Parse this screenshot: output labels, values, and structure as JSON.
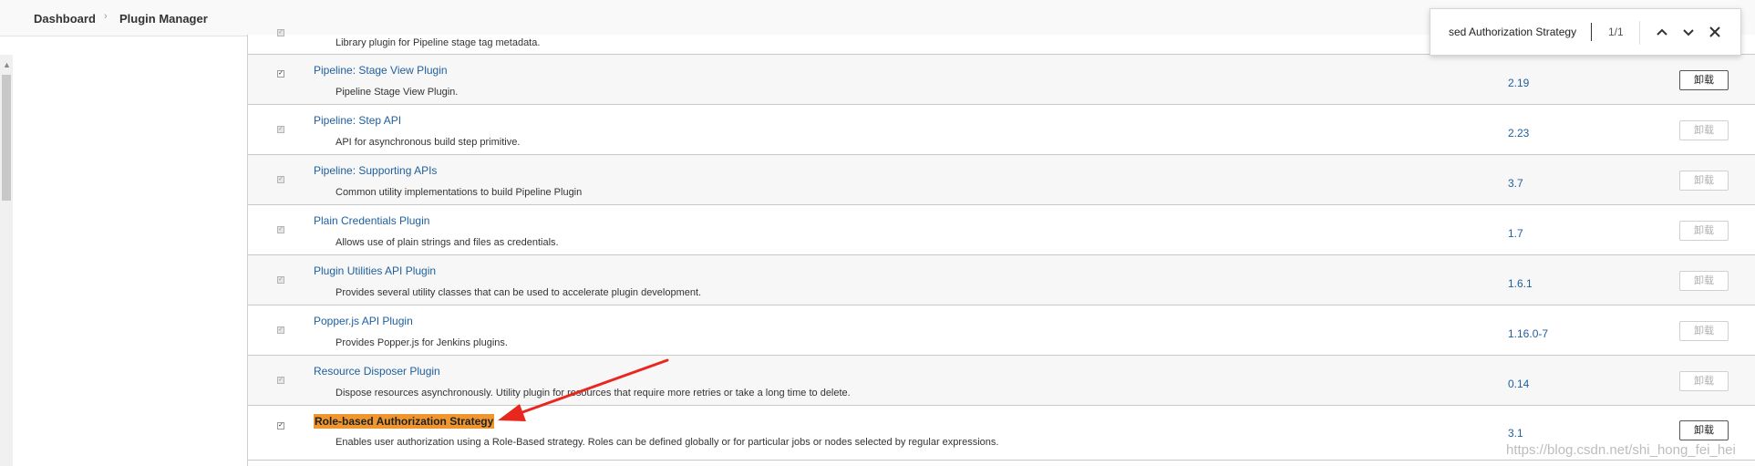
{
  "breadcrumb": {
    "items": [
      "Dashboard",
      "Plugin Manager"
    ]
  },
  "find_bar": {
    "query": "sed Authorization Strategy",
    "match_count": "1/1",
    "icons": [
      "chevron-up-icon",
      "chevron-down-icon",
      "close-icon"
    ]
  },
  "plugins": [
    {
      "name": "",
      "description": "Library plugin for Pipeline stage tag metadata.",
      "version": "",
      "uninstall_label": "",
      "checked": false,
      "enabled": false
    },
    {
      "name": "Pipeline: Stage View Plugin",
      "description": "Pipeline Stage View Plugin.",
      "version": "2.19",
      "uninstall_label": "卸载",
      "checked": true,
      "enabled": true
    },
    {
      "name": "Pipeline: Step API",
      "description": "API for asynchronous build step primitive.",
      "version": "2.23",
      "uninstall_label": "卸载",
      "checked": false,
      "enabled": false
    },
    {
      "name": "Pipeline: Supporting APIs",
      "description": "Common utility implementations to build Pipeline Plugin",
      "version": "3.7",
      "uninstall_label": "卸载",
      "checked": false,
      "enabled": false
    },
    {
      "name": "Plain Credentials Plugin",
      "description": "Allows use of plain strings and files as credentials.",
      "version": "1.7",
      "uninstall_label": "卸载",
      "checked": false,
      "enabled": false
    },
    {
      "name": "Plugin Utilities API Plugin",
      "description": "Provides several utility classes that can be used to accelerate plugin development.",
      "version": "1.6.1",
      "uninstall_label": "卸载",
      "checked": false,
      "enabled": false
    },
    {
      "name": "Popper.js API Plugin",
      "description": "Provides Popper.js for Jenkins plugins.",
      "version": "1.16.0-7",
      "uninstall_label": "卸载",
      "checked": false,
      "enabled": false
    },
    {
      "name": "Resource Disposer Plugin",
      "description": "Dispose resources asynchronously. Utility plugin for resources that require more retries or take a long time to delete.",
      "version": "0.14",
      "uninstall_label": "卸载",
      "checked": false,
      "enabled": false
    },
    {
      "name": "Role-based Authorization Strategy",
      "description": "Enables user authorization using a Role-Based strategy. Roles can be defined globally or for particular jobs or nodes selected by regular expressions.",
      "version": "3.1",
      "uninstall_label": "卸载",
      "checked": true,
      "enabled": true,
      "highlighted": true
    }
  ],
  "watermark": "https://blog.csdn.net/shi_hong_fei_hei",
  "colors": {
    "link": "#1e5f9e",
    "highlight": "#f0962f",
    "annotation_arrow": "#e8281e"
  }
}
